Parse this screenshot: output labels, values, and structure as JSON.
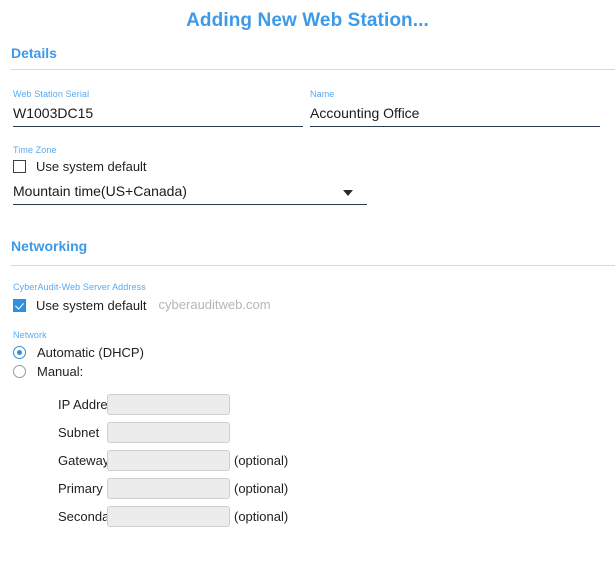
{
  "title": "Adding New Web Station...",
  "sections": {
    "details": {
      "heading": "Details",
      "serial": {
        "label": "Web Station Serial",
        "value": "W1003DC15"
      },
      "name": {
        "label": "Name",
        "value": "Accounting Office"
      },
      "timezone": {
        "label": "Time Zone",
        "use_system_default_label": "Use system default",
        "use_system_default_checked": false,
        "selected_value": "Mountain time(US+Canada)"
      }
    },
    "networking": {
      "heading": "Networking",
      "server_address": {
        "label": "CyberAudit-Web Server Address",
        "use_system_default_label": "Use system default",
        "use_system_default_checked": true,
        "placeholder": "cyberauditweb.com",
        "value": ""
      },
      "network": {
        "label": "Network",
        "options": [
          {
            "label": "Automatic (DHCP)",
            "selected": true
          },
          {
            "label": "Manual:",
            "selected": false
          }
        ],
        "manual_fields": [
          {
            "label": "IP Address",
            "value": "",
            "optional_note": ""
          },
          {
            "label": "Subnet",
            "value": "",
            "optional_note": ""
          },
          {
            "label": "Gateway",
            "value": "",
            "optional_note": "(optional)"
          },
          {
            "label": "Primary DNS",
            "value": "",
            "optional_note": "(optional)"
          },
          {
            "label": "Secondary DNS",
            "value": "",
            "optional_note": "(optional)"
          }
        ]
      }
    }
  },
  "colors": {
    "accent_blue": "#3d9ae8",
    "label_blue": "#5aa9ef",
    "control_blue": "#2f8fe0",
    "underline_dark": "#2c3c50",
    "disabled_field_bg": "#ececec"
  }
}
